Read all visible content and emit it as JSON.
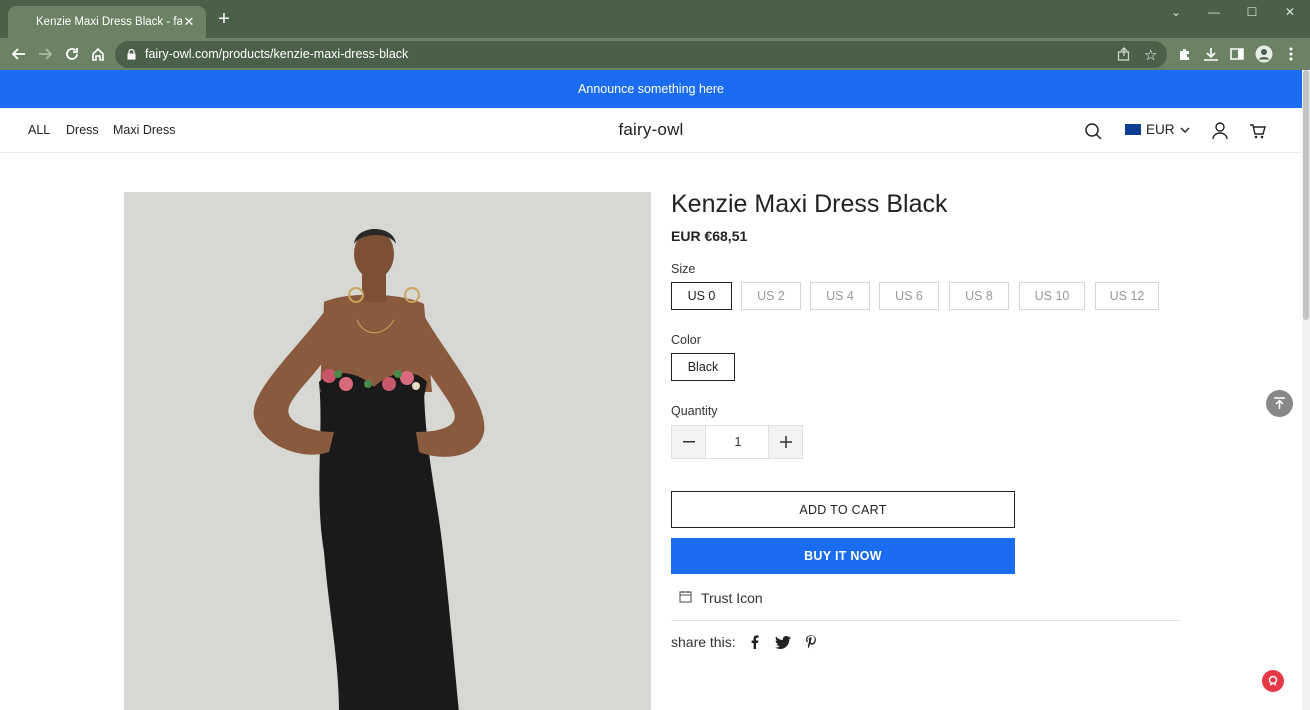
{
  "browser": {
    "tab_title": "Kenzie Maxi Dress Black - fairy-o",
    "url": "fairy-owl.com/products/kenzie-maxi-dress-black"
  },
  "announcement": "Announce something here",
  "header": {
    "menu": [
      "ALL",
      "Dress",
      "Maxi Dress"
    ],
    "logo": "fairy-owl",
    "currency": "EUR"
  },
  "product": {
    "title": "Kenzie Maxi Dress Black",
    "price": "EUR €68,51",
    "size_label": "Size",
    "sizes": [
      "US 0",
      "US 2",
      "US 4",
      "US 6",
      "US 8",
      "US 10",
      "US 12"
    ],
    "selected_size": "US 0",
    "color_label": "Color",
    "color": "Black",
    "quantity_label": "Quantity",
    "quantity": "1",
    "add_to_cart": "ADD TO CART",
    "buy_now": "BUY IT NOW",
    "trust_text": "Trust Icon",
    "share_label": "share this:"
  },
  "colors": {
    "brand_blue": "#1a6cf0",
    "chrome_dark": "#4a6049",
    "chrome_light": "#6b8264"
  }
}
